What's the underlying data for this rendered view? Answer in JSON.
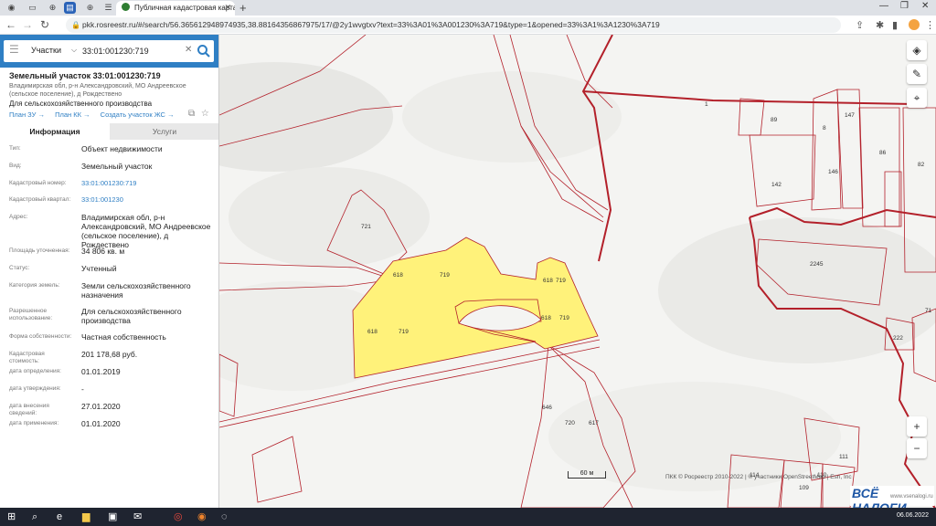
{
  "browser": {
    "tab_title": "Публичная кадастровая карта",
    "url": "pkk.rosreestr.ru/#/search/56.365612948974935,38.88164356867975/17/@2y1wvgtxv?text=33%3A01%3A001230%3A719&type=1&opened=33%3A1%3A1230%3A719"
  },
  "search": {
    "type": "Участки",
    "value": "33:01:001230:719"
  },
  "card": {
    "title": "Земельный участок 33:01:001230:719",
    "address_short": "Владимирская обл, р-н Александровский, МО Андреевское (сельское поселение), д Рождествено",
    "use": "Для сельскохозяйственного производства",
    "link_plan_zu": "План ЗУ →",
    "link_plan_kk": "План КК →",
    "link_create": "Создать участок ЖС →"
  },
  "tabs": {
    "info": "Информация",
    "services": "Услуги"
  },
  "properties": [
    {
      "label": "Тип:",
      "value": "Объект недвижимости",
      "link": false
    },
    {
      "label": "Вид:",
      "value": "Земельный участок",
      "link": false
    },
    {
      "label": "Кадастровый номер:",
      "value": "33:01:001230:719",
      "link": true
    },
    {
      "label": "Кадастровый квартал:",
      "value": "33:01:001230",
      "link": true
    },
    {
      "label": "Адрес:",
      "value": "Владимирская обл, р-н Александровский, МО Андреевское (сельское поселение), д Рождествено",
      "link": false
    },
    {
      "label": "Площадь уточненная:",
      "value": "34 806 кв. м",
      "link": false
    },
    {
      "label": "Статус:",
      "value": "Учтенный",
      "link": false
    },
    {
      "label": "Категория земель:",
      "value": "Земли сельскохозяйственного назначения",
      "link": false
    },
    {
      "label": "Разрешенное использование:",
      "value": "Для сельскохозяйственного производства",
      "link": false
    },
    {
      "label": "Форма собственности:",
      "value": "Частная собственность",
      "link": false
    },
    {
      "label": "Кадастровая стоимость:",
      "value": "201 178,68 руб.",
      "link": false
    },
    {
      "label": "дата определения:",
      "value": "01.01.2019",
      "link": false
    },
    {
      "label": "дата утверждения:",
      "value": "-",
      "link": false
    },
    {
      "label": "дата внесения сведений:",
      "value": "27.01.2020",
      "link": false
    },
    {
      "label": "дата применения:",
      "value": "01.01.2020",
      "link": false
    }
  ],
  "map": {
    "labels": [
      {
        "text": "721"
      },
      {
        "text": "618"
      },
      {
        "text": "719"
      },
      {
        "text": "618"
      },
      {
        "text": "719"
      },
      {
        "text": "618"
      },
      {
        "text": "719"
      },
      {
        "text": "618"
      },
      {
        "text": "719"
      },
      {
        "text": "646"
      },
      {
        "text": "720"
      },
      {
        "text": "617"
      },
      {
        "text": "142"
      },
      {
        "text": "89"
      },
      {
        "text": "8"
      },
      {
        "text": "147"
      },
      {
        "text": "86"
      },
      {
        "text": "82"
      },
      {
        "text": "146"
      },
      {
        "text": "2245"
      },
      {
        "text": "71"
      },
      {
        "text": "222"
      },
      {
        "text": "111"
      },
      {
        "text": "114"
      },
      {
        "text": "109"
      },
      {
        "text": "110"
      },
      {
        "text": "1"
      }
    ],
    "scale": "60 м",
    "attribution": "ПКК © Росреестр 2010-2022 | © участники OpenStreetMap | Esri, Inc",
    "brand_main": "ВСЁ НАЛОГИ",
    "brand_sub": "www.vsenalogi.ru"
  },
  "taskbar": {
    "clock": "06.06.2022"
  },
  "colors": {
    "accent": "#2f7fc4",
    "parcel_fill": "#fff27a",
    "parcel_border": "#b3202a"
  }
}
